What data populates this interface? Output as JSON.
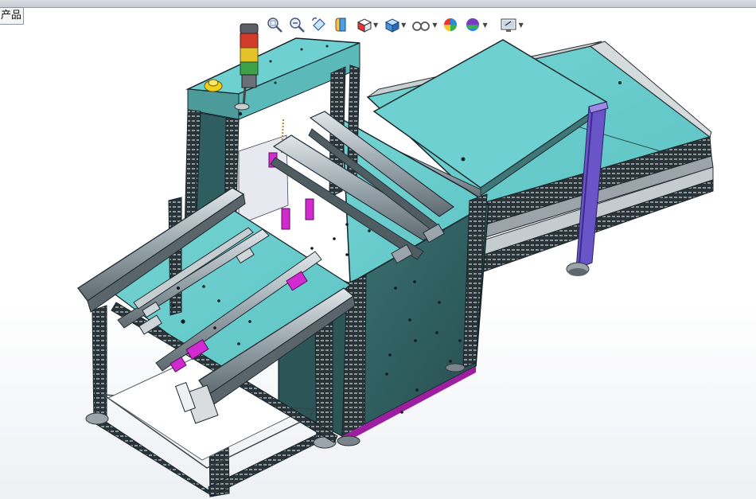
{
  "app": {
    "feature_tree_tab_label": "产品"
  },
  "heads_up_toolbar": {
    "items": [
      {
        "icon": "zoom-to-fit-icon",
        "has_dropdown": false
      },
      {
        "icon": "zoom-to-area-icon",
        "has_dropdown": false
      },
      {
        "icon": "previous-view-icon",
        "has_dropdown": false
      },
      {
        "icon": "section-view-icon",
        "has_dropdown": false
      },
      {
        "icon": "view-orientation-icon",
        "has_dropdown": true
      },
      {
        "icon": "display-style-icon",
        "has_dropdown": true
      },
      {
        "icon": "hide-show-items-icon",
        "has_dropdown": true
      },
      {
        "icon": "edit-appearance-icon",
        "has_dropdown": false
      },
      {
        "icon": "apply-scene-icon",
        "has_dropdown": false
      },
      {
        "icon": "view-settings-icon",
        "has_dropdown": true
      }
    ]
  },
  "colors": {
    "panel_teal": "#66cccc",
    "panel_dark": "#2f5e60",
    "frame_dark": "#1f2a2e",
    "rail_gray": "#b8c0c6",
    "accent_magenta": "#d12ad1",
    "accent_purple": "#6a55c8",
    "light_red": "#d23a2a",
    "light_yellow": "#e4c22a",
    "light_green": "#3fa14a",
    "estop_yellow": "#f1d21f"
  },
  "model": {
    "description_icon": "conveyor-loader-3d-model"
  }
}
